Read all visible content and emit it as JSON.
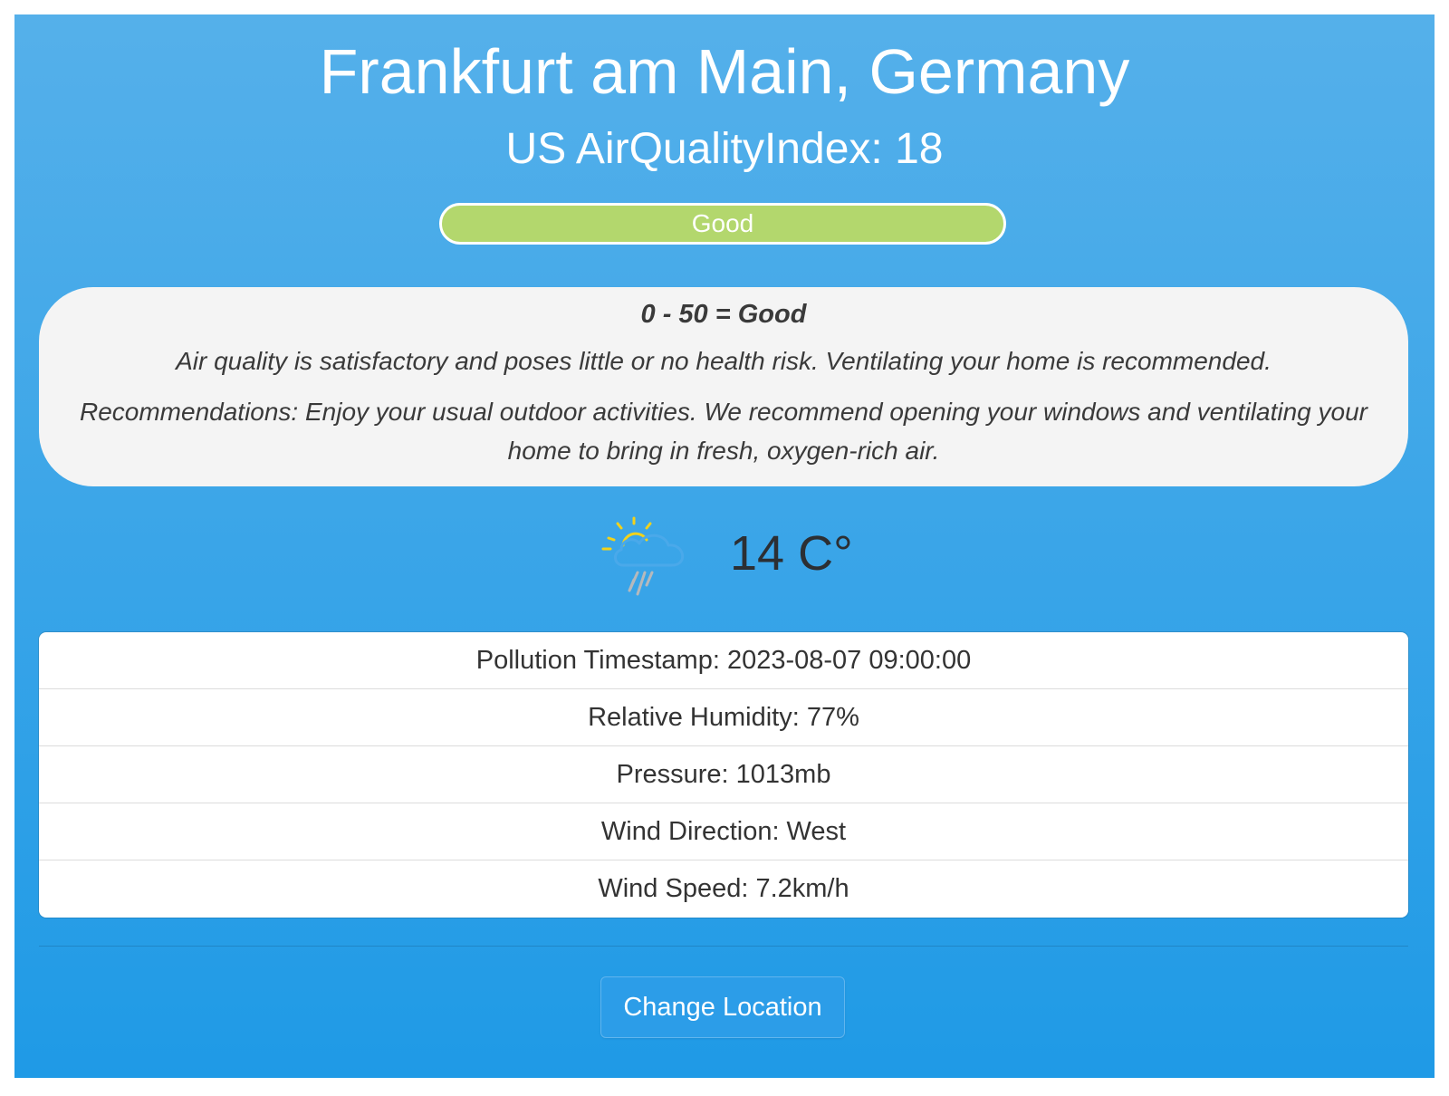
{
  "header": {
    "city": "Frankfurt am Main, Germany",
    "aqi_text": "US AirQualityIndex: 18"
  },
  "aqi": {
    "value": 18,
    "level_label": "Good",
    "level_color": "#b3d76d"
  },
  "info": {
    "range_label": "0 - 50 = Good",
    "description": "Air quality is satisfactory and poses little or no health risk. Ventilating your home is recommended.",
    "recommendations": "Recommendations: Enjoy your usual outdoor activities. We recommend opening your windows and ventilating your home to bring in fresh, oxygen-rich air."
  },
  "weather": {
    "icon": "partly-sunny-rain-icon",
    "temperature": "14 C°"
  },
  "stats": [
    "Pollution Timestamp: 2023-08-07 09:00:00",
    "Relative Humidity: 77%",
    "Pressure: 1013mb",
    "Wind Direction: West",
    "Wind Speed: 7.2km/h"
  ],
  "actions": {
    "change_location_label": "Change Location"
  },
  "colors": {
    "panel_top": "#55b0ea",
    "panel_bottom": "#1f9ae6",
    "button": "#2c9de8",
    "info_box": "#f4f4f4"
  }
}
